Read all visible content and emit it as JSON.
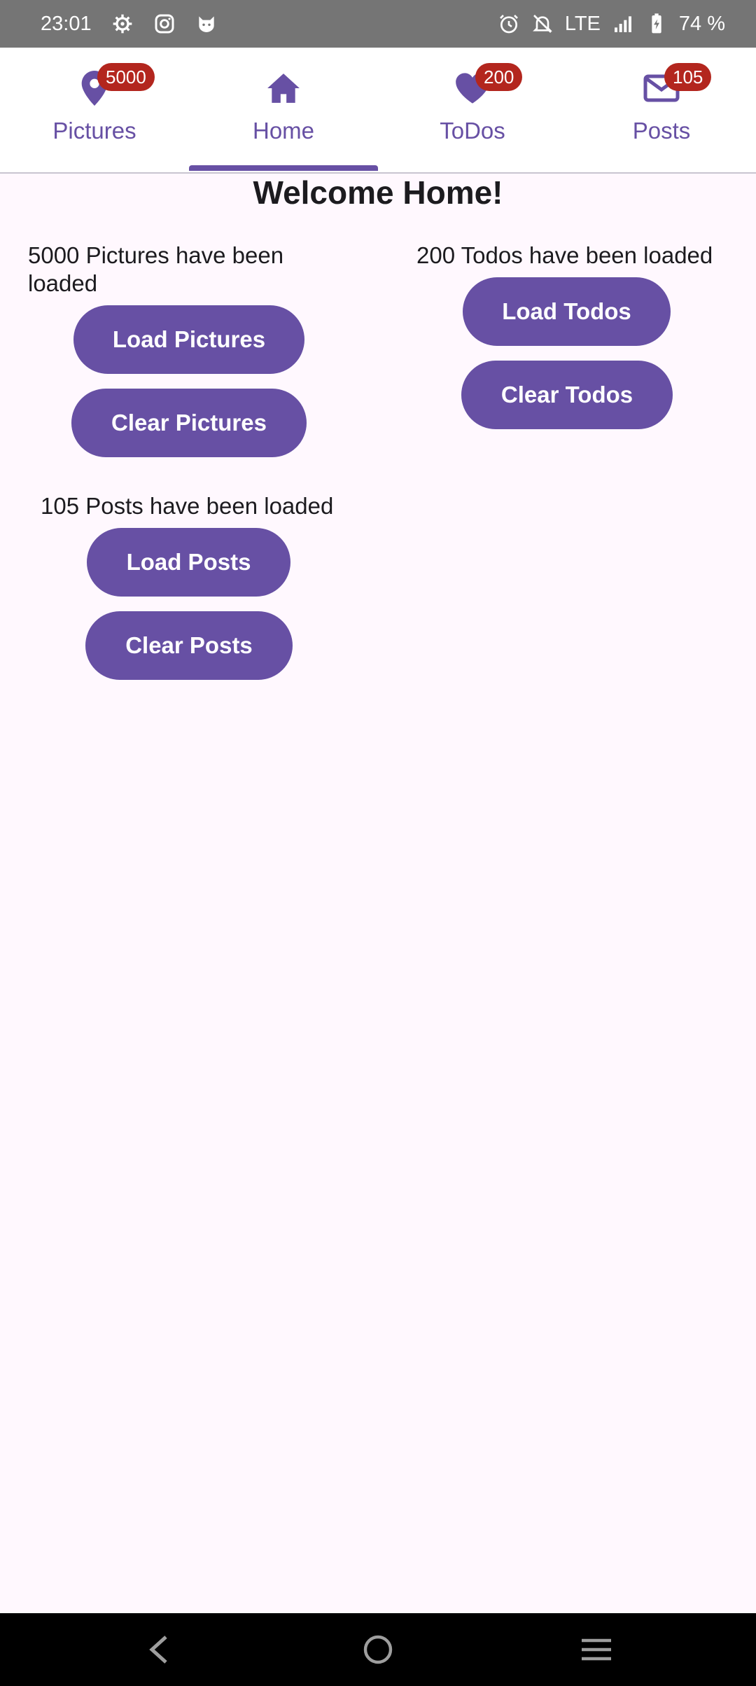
{
  "status_bar": {
    "time": "23:01",
    "network": "LTE",
    "battery": "74 %",
    "icons_left": [
      "settings-icon",
      "instagram-icon",
      "cat-icon"
    ],
    "icons_right": [
      "alarm-icon",
      "bell-off-icon",
      "signal-icon",
      "battery-charging-icon"
    ]
  },
  "tabs": [
    {
      "label": "Pictures",
      "icon": "location-pin-icon",
      "badge": "5000"
    },
    {
      "label": "Home",
      "icon": "home-icon",
      "badge": ""
    },
    {
      "label": "ToDos",
      "icon": "heart-icon",
      "badge": "200"
    },
    {
      "label": "Posts",
      "icon": "mail-icon",
      "badge": "105"
    }
  ],
  "selected_tab": "Home",
  "main": {
    "title": "Welcome Home!",
    "pictures": {
      "status_line1": "5000 Pictures have been",
      "status_line2": "loaded",
      "load_label": "Load Pictures",
      "clear_label": "Clear Pictures"
    },
    "todos": {
      "status": "200 Todos have been loaded",
      "load_label": "Load Todos",
      "clear_label": "Clear Todos"
    },
    "posts": {
      "status": "105 Posts have been loaded",
      "load_label": "Load Posts",
      "clear_label": "Clear Posts"
    }
  },
  "colors": {
    "primary": "#6750A4",
    "badge": "#B3261E",
    "background": "#FFF8FE",
    "status_bar": "#757575"
  }
}
